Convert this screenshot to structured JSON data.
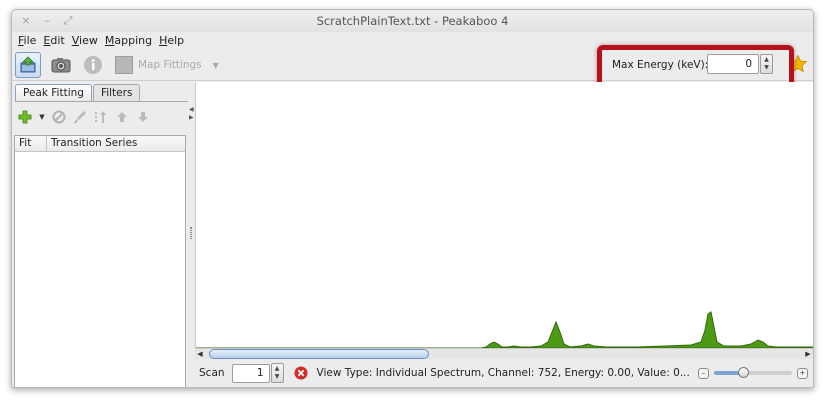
{
  "window": {
    "title": "ScratchPlainText.txt - Peakaboo 4",
    "controls": [
      "×",
      "–",
      "⤢"
    ]
  },
  "menu": [
    {
      "accel": "F",
      "rest": "ile"
    },
    {
      "accel": "E",
      "rest": "dit"
    },
    {
      "accel": "V",
      "rest": "iew"
    },
    {
      "accel": "M",
      "rest": "apping"
    },
    {
      "accel": "H",
      "rest": "elp"
    }
  ],
  "toolbar": {
    "map_fittings_label": "Map Fittings",
    "max_energy_label": "Max Energy (keV):",
    "max_energy_value": "0",
    "icons": {
      "open": "open-file-icon",
      "screenshot": "camera-icon",
      "info": "info-icon",
      "map": "map-icon",
      "favorite": "star-icon"
    }
  },
  "side_panel": {
    "tabs": [
      "Peak Fitting",
      "Filters"
    ],
    "active_tab": "Peak Fitting",
    "table_columns": [
      "Fit",
      "Transition Series"
    ],
    "tool_icons": [
      "add-icon",
      "dropdown-arrow-icon",
      "cancel-icon",
      "brush-icon",
      "sort-icon",
      "move-up-icon",
      "move-down-icon"
    ]
  },
  "status_bar": {
    "scan_label": "Scan",
    "scan_value": "1",
    "status_text": "View Type: Individual Spectrum,  Channel: 752,  Energy: 0.00,  Value: 0..."
  },
  "colors": {
    "spectrum_fill": "#4c9a16",
    "spectrum_stroke": "#2f6b06",
    "highlight_box": "#b5121b",
    "error_icon": "#d42a2a",
    "star": "#f4b400"
  }
}
